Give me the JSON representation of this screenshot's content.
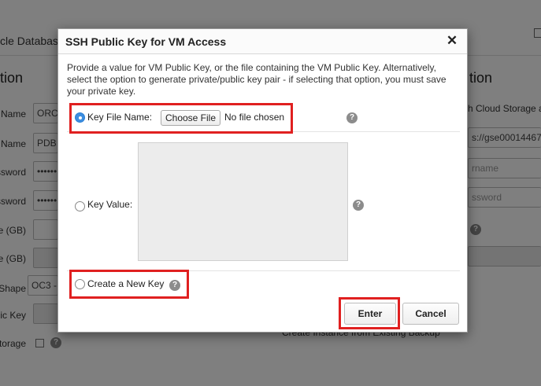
{
  "background": {
    "top_title": "cle Databas",
    "left_heading": "tion",
    "right_heading": "tion",
    "left_labels": [
      "Name",
      "Name",
      "ssword",
      "ssword",
      "e (GB)",
      "e (GB)",
      "Shape",
      "lic Key",
      "torage"
    ],
    "left_field_values": [
      "ORC",
      "PDB",
      "••••••",
      "••••••",
      "",
      "",
      "OC3 -",
      ""
    ],
    "right_texts": [
      "h Cloud Storage a",
      "s://gse00014467.",
      "rname",
      "ssword"
    ],
    "bottom_text": "Create Instance from Existing Backup"
  },
  "dialog": {
    "title": "SSH Public Key for VM Access",
    "close_symbol": "✕",
    "description": "Provide a value for VM Public Key, or the file containing the VM Public Key. Alternatively, select the option to generate private/public key pair - if selecting that option, you must save your private key.",
    "options": {
      "key_file": {
        "label": "Key File Name:",
        "selected": true,
        "choose_file_label": "Choose File",
        "file_status": "No file chosen"
      },
      "key_value": {
        "label": "Key Value:",
        "selected": false,
        "value": ""
      },
      "new_key": {
        "label": "Create a New Key",
        "selected": false
      }
    },
    "help_symbol": "?",
    "buttons": {
      "enter": "Enter",
      "cancel": "Cancel"
    }
  },
  "colors": {
    "highlight": "#e02020",
    "radio_selected": "#3d8ee0",
    "overlay": "#7d7d7d"
  }
}
